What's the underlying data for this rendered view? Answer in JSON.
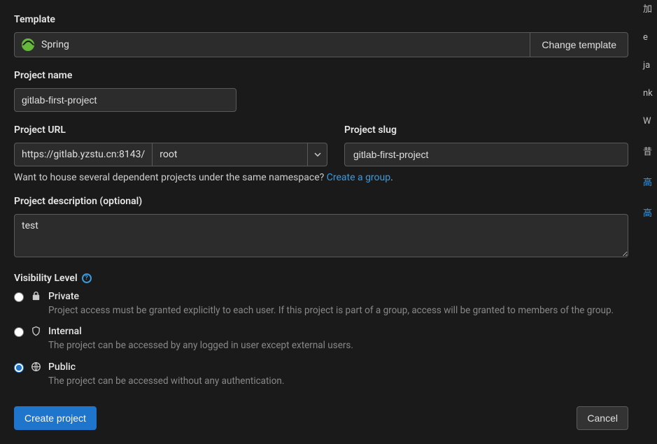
{
  "template": {
    "label": "Template",
    "name": "Spring",
    "change_label": "Change template"
  },
  "project_name": {
    "label": "Project name",
    "value": "gitlab-first-project"
  },
  "project_url": {
    "label": "Project URL",
    "prefix": "https://gitlab.yzstu.cn:8143/",
    "namespace": "root"
  },
  "project_slug": {
    "label": "Project slug",
    "value": "gitlab-first-project"
  },
  "hint": {
    "text": "Want to house several dependent projects under the same namespace? ",
    "link": "Create a group"
  },
  "description": {
    "label": "Project description (optional)",
    "value": "test"
  },
  "visibility": {
    "label": "Visibility Level",
    "options": [
      {
        "name": "Private",
        "desc": "Project access must be granted explicitly to each user. If this project is part of a group, access will be granted to members of the group.",
        "checked": false
      },
      {
        "name": "Internal",
        "desc": "The project can be accessed by any logged in user except external users.",
        "checked": false
      },
      {
        "name": "Public",
        "desc": "The project can be accessed without any authentication.",
        "checked": true
      }
    ]
  },
  "buttons": {
    "create": "Create project",
    "cancel": "Cancel"
  },
  "side": [
    "加",
    "e",
    "ja",
    "nk",
    "W",
    "昔",
    "高",
    "高"
  ]
}
